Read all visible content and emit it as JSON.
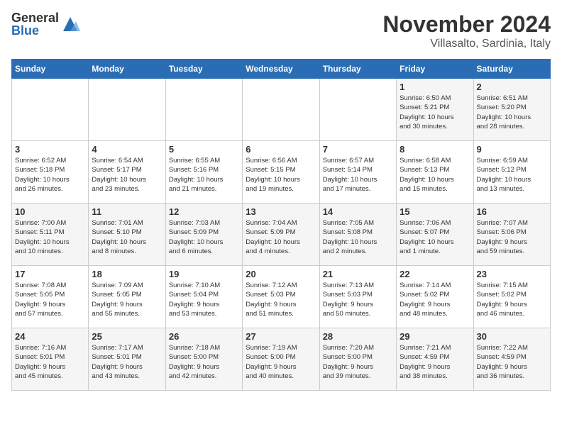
{
  "header": {
    "logo_general": "General",
    "logo_blue": "Blue",
    "month": "November 2024",
    "location": "Villasalto, Sardinia, Italy"
  },
  "weekdays": [
    "Sunday",
    "Monday",
    "Tuesday",
    "Wednesday",
    "Thursday",
    "Friday",
    "Saturday"
  ],
  "weeks": [
    [
      {
        "day": "",
        "info": ""
      },
      {
        "day": "",
        "info": ""
      },
      {
        "day": "",
        "info": ""
      },
      {
        "day": "",
        "info": ""
      },
      {
        "day": "",
        "info": ""
      },
      {
        "day": "1",
        "info": "Sunrise: 6:50 AM\nSunset: 5:21 PM\nDaylight: 10 hours\nand 30 minutes."
      },
      {
        "day": "2",
        "info": "Sunrise: 6:51 AM\nSunset: 5:20 PM\nDaylight: 10 hours\nand 28 minutes."
      }
    ],
    [
      {
        "day": "3",
        "info": "Sunrise: 6:52 AM\nSunset: 5:18 PM\nDaylight: 10 hours\nand 26 minutes."
      },
      {
        "day": "4",
        "info": "Sunrise: 6:54 AM\nSunset: 5:17 PM\nDaylight: 10 hours\nand 23 minutes."
      },
      {
        "day": "5",
        "info": "Sunrise: 6:55 AM\nSunset: 5:16 PM\nDaylight: 10 hours\nand 21 minutes."
      },
      {
        "day": "6",
        "info": "Sunrise: 6:56 AM\nSunset: 5:15 PM\nDaylight: 10 hours\nand 19 minutes."
      },
      {
        "day": "7",
        "info": "Sunrise: 6:57 AM\nSunset: 5:14 PM\nDaylight: 10 hours\nand 17 minutes."
      },
      {
        "day": "8",
        "info": "Sunrise: 6:58 AM\nSunset: 5:13 PM\nDaylight: 10 hours\nand 15 minutes."
      },
      {
        "day": "9",
        "info": "Sunrise: 6:59 AM\nSunset: 5:12 PM\nDaylight: 10 hours\nand 13 minutes."
      }
    ],
    [
      {
        "day": "10",
        "info": "Sunrise: 7:00 AM\nSunset: 5:11 PM\nDaylight: 10 hours\nand 10 minutes."
      },
      {
        "day": "11",
        "info": "Sunrise: 7:01 AM\nSunset: 5:10 PM\nDaylight: 10 hours\nand 8 minutes."
      },
      {
        "day": "12",
        "info": "Sunrise: 7:03 AM\nSunset: 5:09 PM\nDaylight: 10 hours\nand 6 minutes."
      },
      {
        "day": "13",
        "info": "Sunrise: 7:04 AM\nSunset: 5:09 PM\nDaylight: 10 hours\nand 4 minutes."
      },
      {
        "day": "14",
        "info": "Sunrise: 7:05 AM\nSunset: 5:08 PM\nDaylight: 10 hours\nand 2 minutes."
      },
      {
        "day": "15",
        "info": "Sunrise: 7:06 AM\nSunset: 5:07 PM\nDaylight: 10 hours\nand 1 minute."
      },
      {
        "day": "16",
        "info": "Sunrise: 7:07 AM\nSunset: 5:06 PM\nDaylight: 9 hours\nand 59 minutes."
      }
    ],
    [
      {
        "day": "17",
        "info": "Sunrise: 7:08 AM\nSunset: 5:05 PM\nDaylight: 9 hours\nand 57 minutes."
      },
      {
        "day": "18",
        "info": "Sunrise: 7:09 AM\nSunset: 5:05 PM\nDaylight: 9 hours\nand 55 minutes."
      },
      {
        "day": "19",
        "info": "Sunrise: 7:10 AM\nSunset: 5:04 PM\nDaylight: 9 hours\nand 53 minutes."
      },
      {
        "day": "20",
        "info": "Sunrise: 7:12 AM\nSunset: 5:03 PM\nDaylight: 9 hours\nand 51 minutes."
      },
      {
        "day": "21",
        "info": "Sunrise: 7:13 AM\nSunset: 5:03 PM\nDaylight: 9 hours\nand 50 minutes."
      },
      {
        "day": "22",
        "info": "Sunrise: 7:14 AM\nSunset: 5:02 PM\nDaylight: 9 hours\nand 48 minutes."
      },
      {
        "day": "23",
        "info": "Sunrise: 7:15 AM\nSunset: 5:02 PM\nDaylight: 9 hours\nand 46 minutes."
      }
    ],
    [
      {
        "day": "24",
        "info": "Sunrise: 7:16 AM\nSunset: 5:01 PM\nDaylight: 9 hours\nand 45 minutes."
      },
      {
        "day": "25",
        "info": "Sunrise: 7:17 AM\nSunset: 5:01 PM\nDaylight: 9 hours\nand 43 minutes."
      },
      {
        "day": "26",
        "info": "Sunrise: 7:18 AM\nSunset: 5:00 PM\nDaylight: 9 hours\nand 42 minutes."
      },
      {
        "day": "27",
        "info": "Sunrise: 7:19 AM\nSunset: 5:00 PM\nDaylight: 9 hours\nand 40 minutes."
      },
      {
        "day": "28",
        "info": "Sunrise: 7:20 AM\nSunset: 5:00 PM\nDaylight: 9 hours\nand 39 minutes."
      },
      {
        "day": "29",
        "info": "Sunrise: 7:21 AM\nSunset: 4:59 PM\nDaylight: 9 hours\nand 38 minutes."
      },
      {
        "day": "30",
        "info": "Sunrise: 7:22 AM\nSunset: 4:59 PM\nDaylight: 9 hours\nand 36 minutes."
      }
    ]
  ]
}
